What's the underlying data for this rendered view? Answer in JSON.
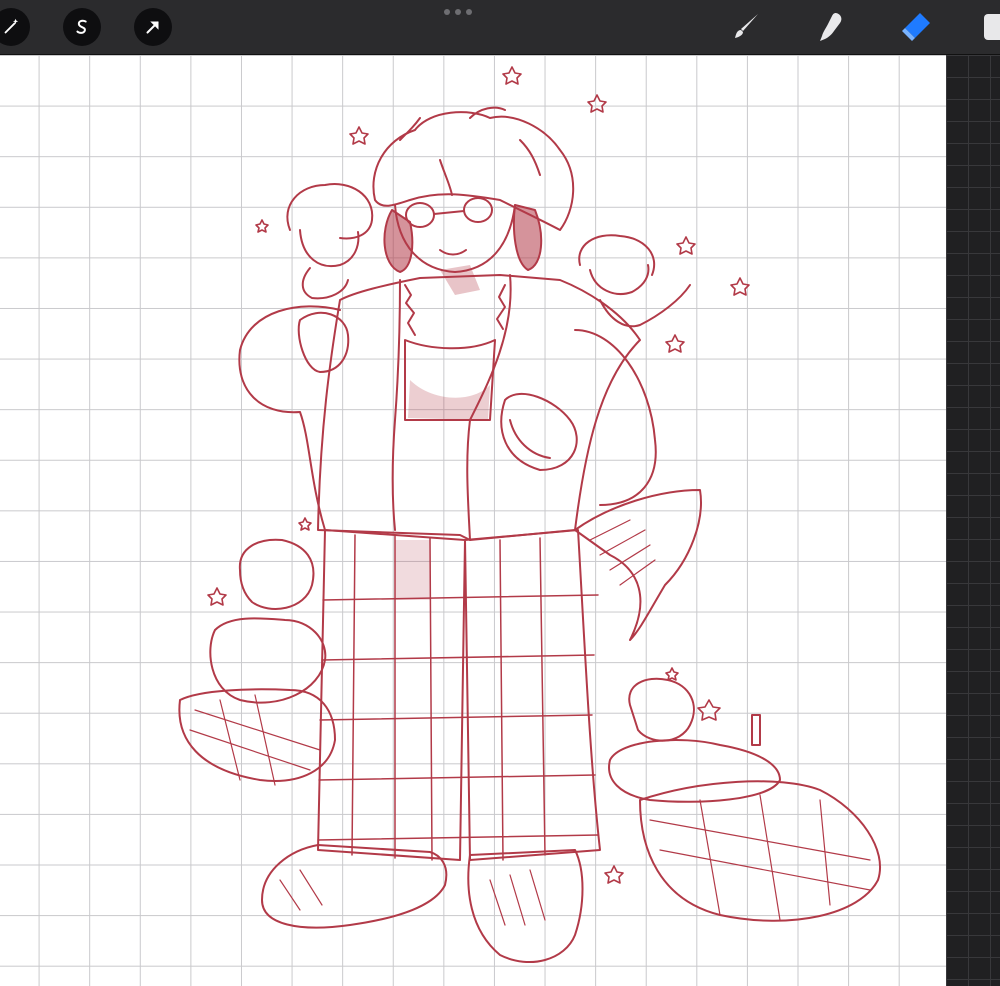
{
  "app": {
    "accent_color": "#1f7bff",
    "sketch_color": "#b23a48"
  },
  "toolbar": {
    "left_buttons": [
      {
        "name": "adjustments",
        "icon": "magic-wand-icon"
      },
      {
        "name": "selection",
        "icon": "selection-s-icon"
      },
      {
        "name": "transform",
        "icon": "arrow-cursor-icon"
      }
    ],
    "right_tools": [
      {
        "name": "brush",
        "icon": "brush-icon",
        "active": false
      },
      {
        "name": "smudge",
        "icon": "smudge-finger-icon",
        "active": false
      },
      {
        "name": "eraser",
        "icon": "eraser-icon",
        "active": true
      }
    ]
  },
  "canvas": {
    "background": "#ffffff",
    "grid_color": "#c9c9cc"
  }
}
